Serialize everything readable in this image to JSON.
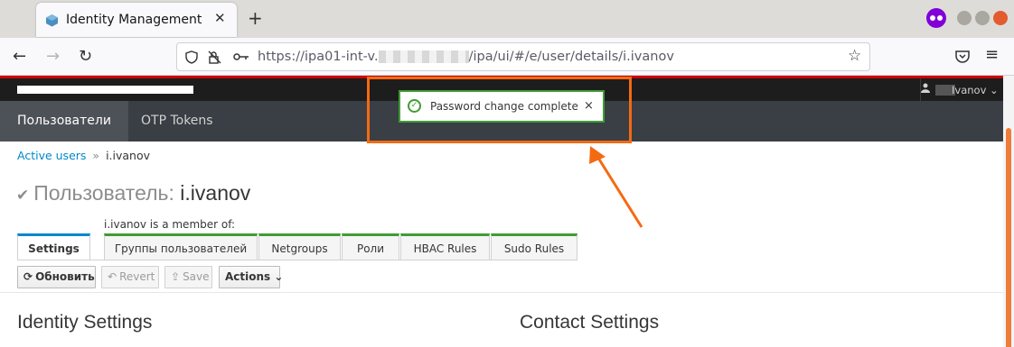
{
  "browser": {
    "tab_title": "Identity Management",
    "tab_close": "✕",
    "new_tab": "+",
    "url": "https://ipa01-int-v.",
    "url_suffix": "/ipa/ui/#/e/user/details/i.ivanov"
  },
  "app": {
    "user_name": "Ivanov",
    "user_caret": "⌄",
    "menu": [
      {
        "label": "Пользователи",
        "active": true
      },
      {
        "label": "OTP Tokens",
        "active": false
      }
    ],
    "breadcrumb": {
      "link": "Active users",
      "separator": "»",
      "current": "i.ivanov"
    },
    "title": {
      "type": "Пользователь:",
      "name": "i.ivanov"
    },
    "member_of_label": "i.ivanov is a member of:",
    "facet_tabs": [
      "Settings",
      "Группы пользователей",
      "Netgroups",
      "Роли",
      "HBAC Rules",
      "Sudo Rules"
    ],
    "buttons": {
      "refresh": "Обновить",
      "revert": "Revert",
      "save": "Save",
      "actions": "Actions"
    },
    "sections": [
      "Identity Settings",
      "Contact Settings"
    ]
  },
  "notification": {
    "text": "Password change complete",
    "close": "×",
    "status_color": "#3f9c35"
  },
  "colors": {
    "accent": "#0088ce",
    "success": "#3f9c35",
    "header_red": "#cc0000",
    "annotation": "#f46a12"
  }
}
